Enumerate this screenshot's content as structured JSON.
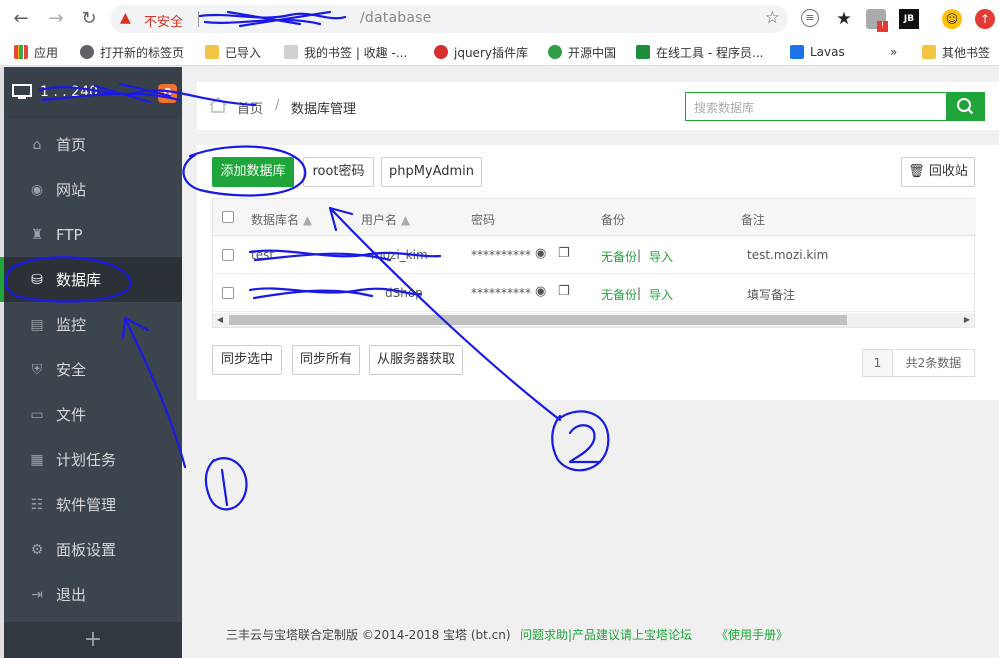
{
  "browser": {
    "insecure_label": "不安全",
    "url_visible": "/database",
    "bookmarks": [
      {
        "label": "应用"
      },
      {
        "label": "打开新的标签页"
      },
      {
        "label": "已导入"
      },
      {
        "label": "我的书签 | 收趣 -..."
      },
      {
        "label": "jquery插件库"
      },
      {
        "label": "开源中国"
      },
      {
        "label": "在线工具 - 程序员..."
      },
      {
        "label": "Lavas"
      },
      {
        "label": "»"
      },
      {
        "label": "其他书签"
      }
    ]
  },
  "sidebar": {
    "server_ip_visible": "1 . . 240",
    "badge": "0",
    "items": [
      {
        "label": "首页",
        "icon": "home-icon"
      },
      {
        "label": "网站",
        "icon": "globe-icon"
      },
      {
        "label": "FTP",
        "icon": "ftp-icon"
      },
      {
        "label": "数据库",
        "icon": "database-icon",
        "active": true
      },
      {
        "label": "监控",
        "icon": "monitor-chart-icon"
      },
      {
        "label": "安全",
        "icon": "shield-icon"
      },
      {
        "label": "文件",
        "icon": "folder-icon"
      },
      {
        "label": "计划任务",
        "icon": "calendar-icon"
      },
      {
        "label": "软件管理",
        "icon": "apps-icon"
      },
      {
        "label": "面板设置",
        "icon": "gear-icon"
      },
      {
        "label": "退出",
        "icon": "logout-icon"
      }
    ],
    "add_label": "+"
  },
  "breadcrumb": {
    "home": "首页",
    "separator": "/",
    "current": "数据库管理"
  },
  "search": {
    "placeholder": "搜索数据库"
  },
  "toolbar": {
    "add_db": "添加数据库",
    "root_pwd": "root密码",
    "phpmyadmin": "phpMyAdmin",
    "recycle": "回收站"
  },
  "table": {
    "headers": [
      "数据库名",
      "用户名",
      "密码",
      "备份",
      "备注"
    ],
    "rows": [
      {
        "name": "test",
        "user": "mozi_kim",
        "password": "**********",
        "backup_none": "无备份",
        "sep": " | ",
        "import": "导入",
        "note": "test.mozi.kim"
      },
      {
        "name": "",
        "user": "dShop",
        "password": "**********",
        "backup_none": "无备份",
        "sep": " | ",
        "import": "导入",
        "note": "填写备注"
      }
    ]
  },
  "actions": {
    "sync_selected": "同步选中",
    "sync_all": "同步所有",
    "fetch_server": "从服务器获取"
  },
  "pagination": {
    "page": "1",
    "total": "共2条数据"
  },
  "footer": {
    "copyright": "三丰云与宝塔联合定制版 ©2014-2018 宝塔 (bt.cn)",
    "help": "问题求助|产品建议请上宝塔论坛",
    "manual": "《使用手册》"
  },
  "annotations": {
    "label_1": "1",
    "label_2": "2"
  },
  "colors": {
    "accent_green": "#20a53a",
    "sidebar_bg": "#3c444d",
    "badge_orange": "#f0712c",
    "annotation_blue": "#1a1ae6"
  }
}
